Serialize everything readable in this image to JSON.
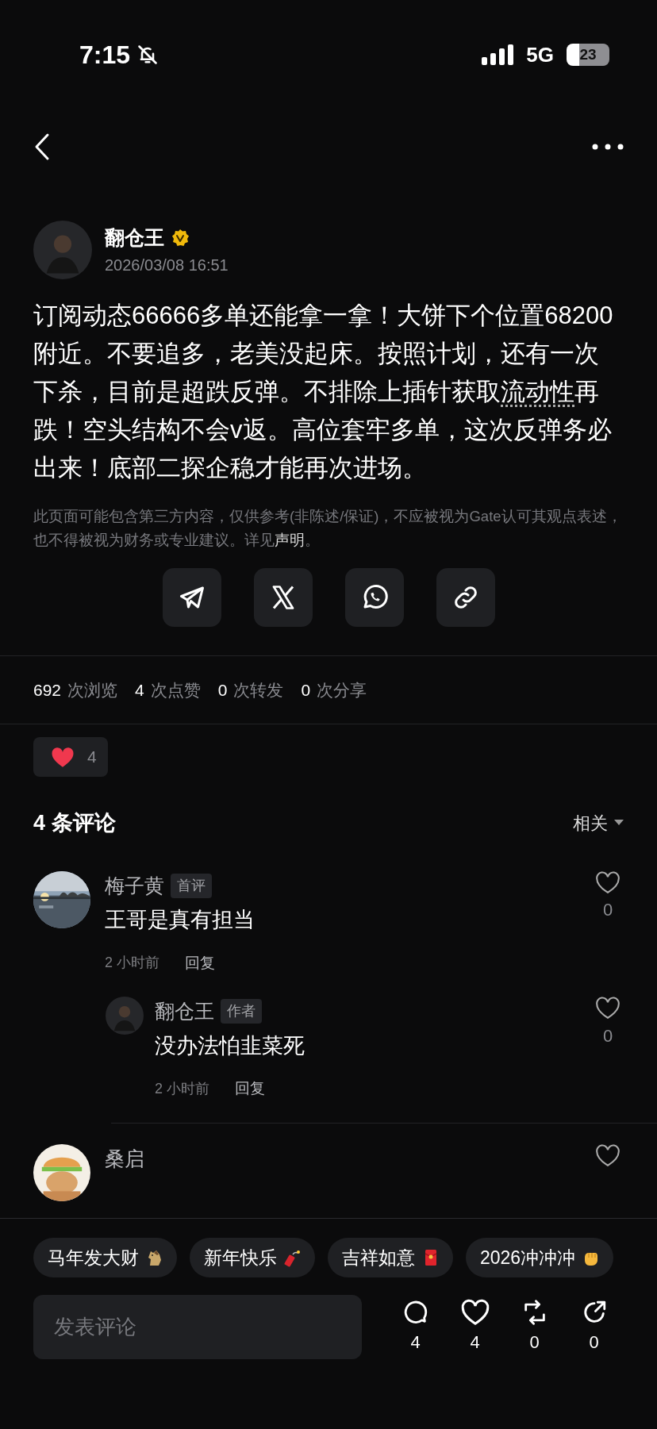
{
  "status_bar": {
    "time": "7:15",
    "network": "5G",
    "battery": "23"
  },
  "author": {
    "name": "翻仓王",
    "verified": true,
    "date": "2026/03/08 16:51"
  },
  "post": {
    "body": [
      {
        "kind": "plain",
        "text": "订阅动态66666多单还能拿一拿！大饼下个位置68200附近。不要追多，老美没起床。按照计划，还有一次下杀，目前是超跌反弹。不排除上插针获取"
      },
      {
        "kind": "term",
        "text": "流动性"
      },
      {
        "kind": "plain",
        "text": "再跌！空头结构不会v返。高位套牢多单，这次反弹务必出来！底部二探企稳才能再次进场。"
      }
    ],
    "disclaimer": [
      {
        "kind": "plain",
        "text": "此页面可能包含第三方内容，仅供参考(非陈述/保证)，不应被视为Gate认可其观点表述，也不得被视为财务或专业建议。详见"
      },
      {
        "kind": "link",
        "text": "声明"
      },
      {
        "kind": "plain",
        "text": "。"
      }
    ]
  },
  "stats": [
    {
      "count": "692",
      "label": "次浏览"
    },
    {
      "count": "4",
      "label": "次点赞"
    },
    {
      "count": "0",
      "label": "次转发"
    },
    {
      "count": "0",
      "label": "次分享"
    }
  ],
  "reaction": {
    "count": "4"
  },
  "comments_header": {
    "title": "4 条评论",
    "sort": "相关"
  },
  "comments": [
    {
      "author": "梅子黄",
      "avatar": {
        "kind": "picture"
      },
      "badge": "首评",
      "text": "王哥是真有担当",
      "time": "2 小时前",
      "reply": "回复",
      "likes": "0",
      "liked": false,
      "children": [
        {
          "author": "翻仓王",
          "avatar": {
            "kind": "figure"
          },
          "badge": "作者",
          "text": "没办法怕韭菜死",
          "time": "2 小时前",
          "reply": "回复",
          "likes": "0",
          "liked": false
        }
      ]
    },
    {
      "author": "桑启",
      "avatar": {
        "kind": "picture"
      },
      "liked": false
    }
  ],
  "quick_replies": [
    {
      "label": "马年发大财"
    },
    {
      "label": "新年快乐"
    },
    {
      "label": "吉祥如意"
    },
    {
      "label": "2026冲冲冲"
    }
  ],
  "composer": {
    "placeholder": "发表评论"
  },
  "actions": [
    {
      "count": "4"
    },
    {
      "count": "4"
    },
    {
      "count": "0"
    },
    {
      "count": "0"
    }
  ]
}
